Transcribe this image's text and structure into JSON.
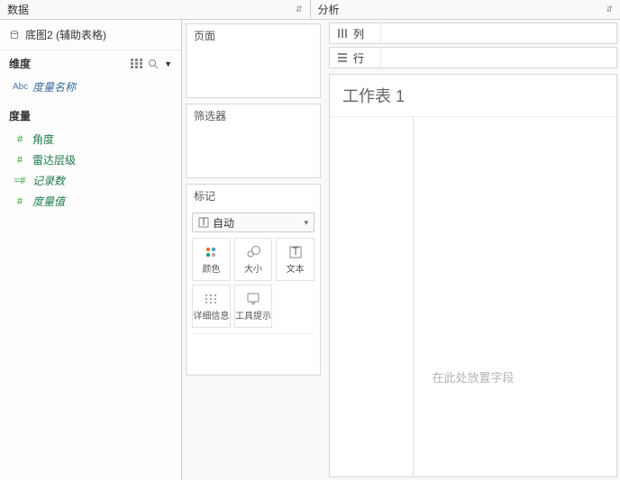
{
  "tabs": {
    "data": "数据",
    "analysis": "分析"
  },
  "datasource": {
    "name": "底图2 (辅助表格)"
  },
  "sections": {
    "dimensions": "维度",
    "measures": "度量"
  },
  "dim_fields": [
    {
      "type_label": "Abc",
      "name": "度量名称"
    }
  ],
  "mea_fields": [
    {
      "name": "角度",
      "italic": false
    },
    {
      "name": "雷达层级",
      "italic": false
    },
    {
      "name": "记录数",
      "italic": true
    },
    {
      "name": "度量值",
      "italic": true
    }
  ],
  "cards": {
    "pages": "页面",
    "filters": "筛选器",
    "marks": "标记"
  },
  "marks": {
    "auto": "自动",
    "cells": {
      "color": "颜色",
      "size": "大小",
      "text": "文本",
      "detail": "详细信息",
      "tooltip": "工具提示"
    }
  },
  "shelves": {
    "columns": "列",
    "rows": "行"
  },
  "worksheet": {
    "title": "工作表 1",
    "placeholder": "在此处放置字段"
  },
  "icons": {
    "dropdown": "▾",
    "search": "🔍",
    "menu": "▼"
  },
  "colors": {
    "dim": "#4e79a7",
    "mea": "#2ca02c",
    "muted": "#b5b5b5"
  }
}
